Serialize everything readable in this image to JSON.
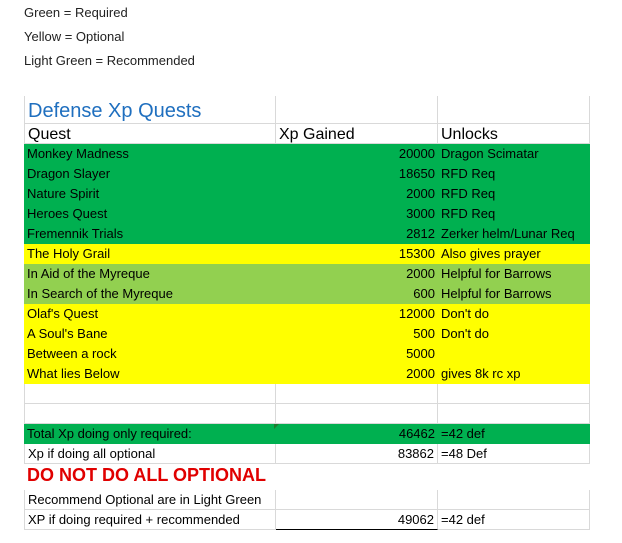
{
  "legend": [
    "Green = Required",
    "Yellow = Optional",
    "Light Green = Recommended"
  ],
  "sheet": {
    "title": "Defense Xp Quests",
    "headers": [
      "Quest",
      "Xp Gained",
      "Unlocks"
    ],
    "rows": [
      {
        "quest": "Monkey Madness",
        "xp": "20000",
        "unlocks": "Dragon Scimatar",
        "color": "green"
      },
      {
        "quest": "Dragon Slayer",
        "xp": "18650",
        "unlocks": "RFD Req",
        "color": "green"
      },
      {
        "quest": "Nature Spirit",
        "xp": "2000",
        "unlocks": "RFD Req",
        "color": "green"
      },
      {
        "quest": "Heroes Quest",
        "xp": "3000",
        "unlocks": "RFD Req",
        "color": "green"
      },
      {
        "quest": "Fremennik Trials",
        "xp": "2812",
        "unlocks": "Zerker helm/Lunar Req",
        "color": "green"
      },
      {
        "quest": "The Holy Grail",
        "xp": "15300",
        "unlocks": "Also gives prayer",
        "color": "yellow"
      },
      {
        "quest": "In Aid of the Myreque",
        "xp": "2000",
        "unlocks": "Helpful for Barrows",
        "color": "lightgreen"
      },
      {
        "quest": "In Search of the Myreque",
        "xp": "600",
        "unlocks": "Helpful for Barrows",
        "color": "lightgreen"
      },
      {
        "quest": "Olaf's Quest",
        "xp": "12000",
        "unlocks": "Don't do",
        "color": "yellow"
      },
      {
        "quest": "A Soul's Bane",
        "xp": "500",
        "unlocks": "Don't do",
        "color": "yellow"
      },
      {
        "quest": "Between a rock",
        "xp": "5000",
        "unlocks": "",
        "color": "yellow"
      },
      {
        "quest": "What lies Below",
        "xp": "2000",
        "unlocks": "gives 8k rc xp",
        "color": "yellow"
      }
    ],
    "summary": {
      "required": {
        "label": "Total Xp doing only required:",
        "xp": "46462",
        "note": "=42 def",
        "color": "green"
      },
      "all_optional": {
        "label": "Xp if doing all optional",
        "xp": "83862",
        "note": "=48 Def"
      },
      "warning": "DO NOT DO ALL OPTIONAL",
      "recommend_note": "Recommend Optional are in Light Green",
      "recommended": {
        "label": "XP if doing required + recommended",
        "xp": "49062",
        "note": "=42 def"
      }
    }
  },
  "colors": {
    "required": "#00b050",
    "optional": "#ffff00",
    "recommended": "#92d050",
    "title": "#1f6fbf",
    "warning": "#e00000"
  }
}
